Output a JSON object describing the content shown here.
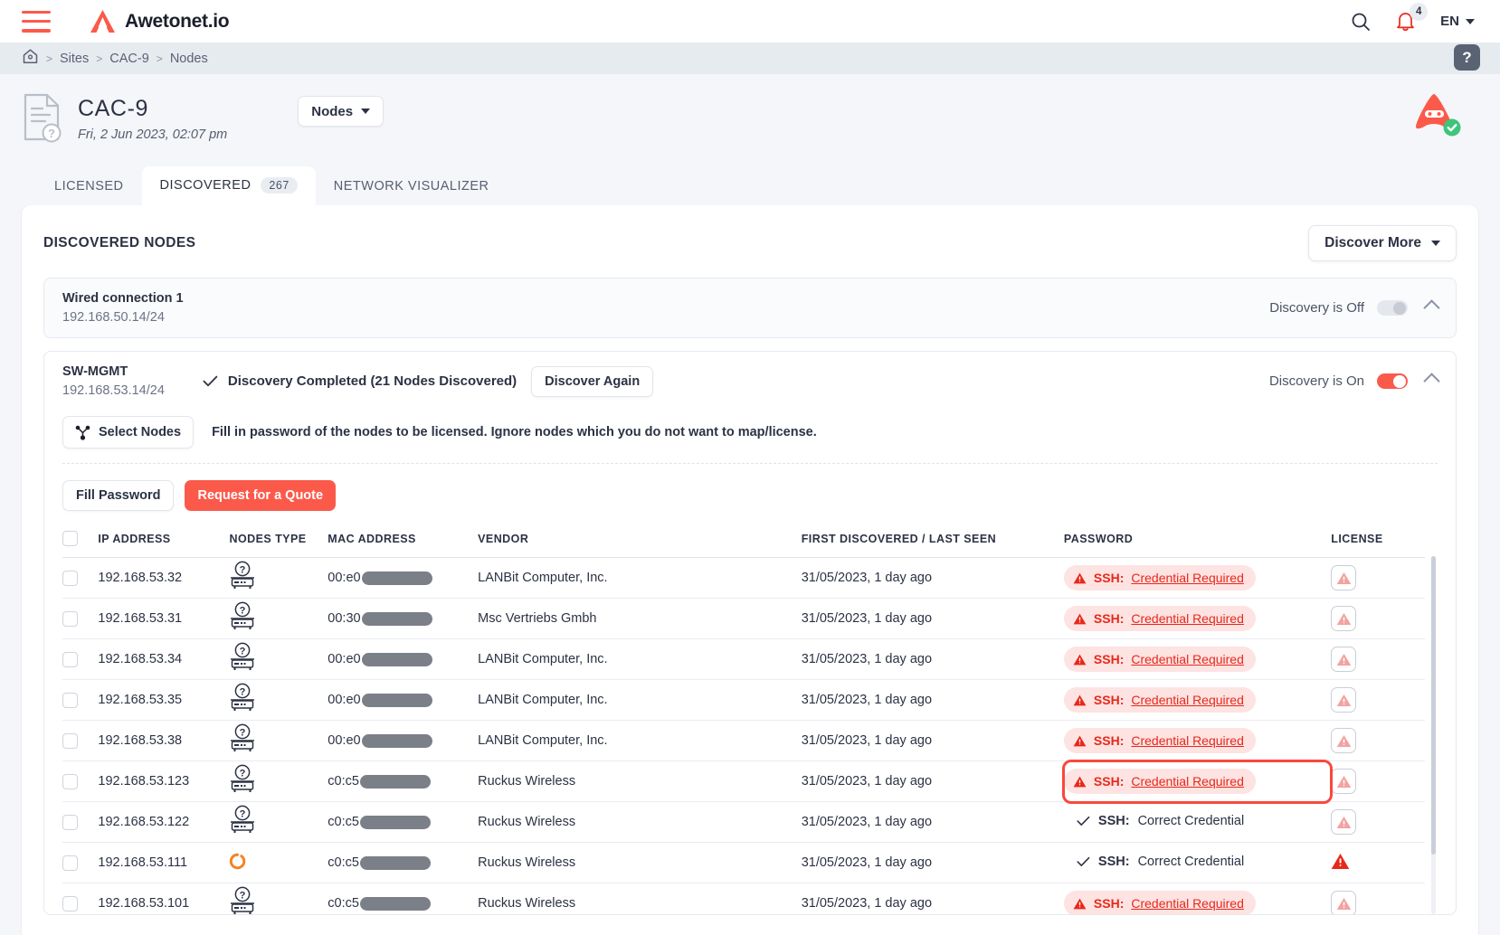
{
  "topbar": {
    "brand": "Awetonet.io",
    "search_icon": "search-icon",
    "bell_icon": "notification-bell-icon",
    "notification_count": "4",
    "language": "EN"
  },
  "breadcrumb": {
    "home_icon": "home-icon",
    "items": [
      "Sites",
      "CAC-9",
      "Nodes"
    ],
    "separator": ">",
    "help_label": "?"
  },
  "page": {
    "site_name": "CAC-9",
    "site_date": "Fri, 2 Jun 2023, 02:07 pm",
    "nodes_dropdown": "Nodes",
    "mascot_icon": "ninja-robot-mascot-icon",
    "mascot_status_icon": "check-badge-icon"
  },
  "tabs": [
    {
      "label": "LICENSED",
      "count": "",
      "active": false
    },
    {
      "label": "DISCOVERED",
      "count": "267",
      "active": true
    },
    {
      "label": "NETWORK VISUALIZER",
      "count": "",
      "active": false
    }
  ],
  "card": {
    "title": "DISCOVERED NODES",
    "discover_more": "Discover More"
  },
  "panels": [
    {
      "name": "Wired connection 1",
      "subnet": "192.168.50.14/24",
      "toggle_label": "Discovery is Off",
      "toggle_on": false,
      "status": "",
      "discover_again": ""
    },
    {
      "name": "SW-MGMT",
      "subnet": "192.168.53.14/24",
      "toggle_label": "Discovery is On",
      "toggle_on": true,
      "status": "Discovery Completed (21 Nodes Discovered)",
      "discover_again": "Discover Again"
    }
  ],
  "toolbar": {
    "select_nodes": "Select Nodes",
    "select_nodes_icon": "node-tree-icon",
    "hint": "Fill in password of the nodes to be licensed. Ignore nodes which you do not want to map/license.",
    "fill_password": "Fill Password",
    "request_quote": "Request for a Quote"
  },
  "table": {
    "headers": {
      "ip": "IP ADDRESS",
      "type": "NODES TYPE",
      "mac": "MAC ADDRESS",
      "vendor": "VENDOR",
      "discovered": "FIRST DISCOVERED / LAST SEEN",
      "password": "PASSWORD",
      "license": "LICENSE"
    },
    "password_required_label": "SSH:",
    "password_required_link": "Credential Required",
    "password_ok_prefix": "SSH:",
    "password_ok_value": "Correct Credential",
    "rows": [
      {
        "ip": "192.168.53.32",
        "type_icon": "unknown-node-icon",
        "mac_prefix": "00:e0",
        "vendor": "LANBit Computer, Inc.",
        "discovered": "31/05/2023, 1 day ago",
        "password_state": "required",
        "license_icon": "warning-triangle-icon",
        "license_style": "boxed",
        "highlight": false
      },
      {
        "ip": "192.168.53.31",
        "type_icon": "unknown-node-icon",
        "mac_prefix": "00:30",
        "vendor": "Msc Vertriebs Gmbh",
        "discovered": "31/05/2023, 1 day ago",
        "password_state": "required",
        "license_icon": "warning-triangle-icon",
        "license_style": "boxed",
        "highlight": false
      },
      {
        "ip": "192.168.53.34",
        "type_icon": "unknown-node-icon",
        "mac_prefix": "00:e0",
        "vendor": "LANBit Computer, Inc.",
        "discovered": "31/05/2023, 1 day ago",
        "password_state": "required",
        "license_icon": "warning-triangle-icon",
        "license_style": "boxed",
        "highlight": false
      },
      {
        "ip": "192.168.53.35",
        "type_icon": "unknown-node-icon",
        "mac_prefix": "00:e0",
        "vendor": "LANBit Computer, Inc.",
        "discovered": "31/05/2023, 1 day ago",
        "password_state": "required",
        "license_icon": "warning-triangle-icon",
        "license_style": "boxed",
        "highlight": false
      },
      {
        "ip": "192.168.53.38",
        "type_icon": "unknown-node-icon",
        "mac_prefix": "00:e0",
        "vendor": "LANBit Computer, Inc.",
        "discovered": "31/05/2023, 1 day ago",
        "password_state": "required",
        "license_icon": "warning-triangle-icon",
        "license_style": "boxed",
        "highlight": false
      },
      {
        "ip": "192.168.53.123",
        "type_icon": "unknown-node-icon",
        "mac_prefix": "c0:c5",
        "vendor": "Ruckus Wireless",
        "discovered": "31/05/2023, 1 day ago",
        "password_state": "required",
        "license_icon": "warning-triangle-icon",
        "license_style": "boxed",
        "highlight": true
      },
      {
        "ip": "192.168.53.122",
        "type_icon": "unknown-node-icon",
        "mac_prefix": "c0:c5",
        "vendor": "Ruckus Wireless",
        "discovered": "31/05/2023, 1 day ago",
        "password_state": "ok",
        "license_icon": "warning-triangle-icon",
        "license_style": "boxed",
        "highlight": false
      },
      {
        "ip": "192.168.53.111",
        "type_icon": "loading-spinner-icon",
        "mac_prefix": "c0:c5",
        "vendor": "Ruckus Wireless",
        "discovered": "31/05/2023, 1 day ago",
        "password_state": "ok",
        "license_icon": "warning-triangle-icon",
        "license_style": "solid",
        "highlight": false
      },
      {
        "ip": "192.168.53.101",
        "type_icon": "unknown-node-icon",
        "mac_prefix": "c0:c5",
        "vendor": "Ruckus Wireless",
        "discovered": "31/05/2023, 1 day ago",
        "password_state": "required",
        "license_icon": "warning-triangle-icon",
        "license_style": "boxed",
        "highlight": false
      }
    ]
  },
  "colors": {
    "accent_red": "#fb5a4b",
    "alert_red": "#e8281a",
    "alert_bg": "#fde3e2",
    "spinner_orange": "#f5821f",
    "success_green": "#3fc47c",
    "page_bg": "#f4f6f9",
    "crumb_bg": "#e6ebf0"
  }
}
